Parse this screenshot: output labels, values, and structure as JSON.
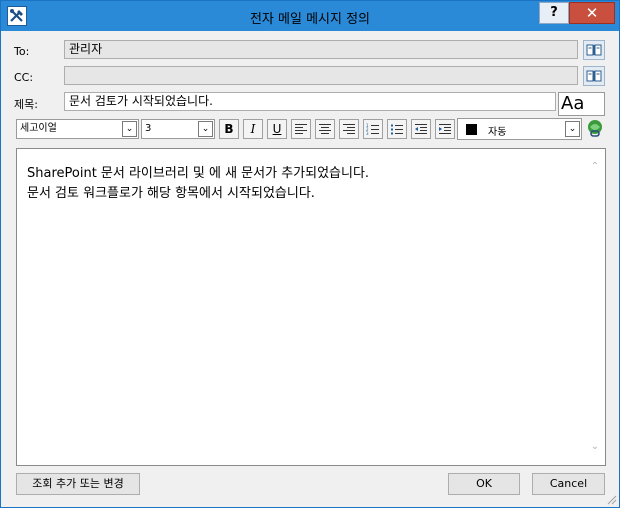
{
  "window": {
    "title": "전자 메일 메시지 정의",
    "help_label": "?",
    "close_label": "✕"
  },
  "fields": {
    "to_label": "To:",
    "to_value": "관리자",
    "cc_label": "CC:",
    "cc_value": "",
    "subject_label": "제목:",
    "subject_value": "문서 검토가 시작되었습니다."
  },
  "icons": {
    "address_book": "address-book-icon",
    "font_dialog": "font-aa-icon",
    "hyperlink": "hyperlink-icon",
    "app": "workflow-tools-icon"
  },
  "format_toolbar": {
    "font_name": "세고이얼",
    "font_size": "3",
    "bold_label": "B",
    "italic_label": "I",
    "underline_label": "U",
    "color_label": "자동",
    "font_dialog_label": "Aa"
  },
  "editor": {
    "line1": "SharePoint 문서 라이브러리 및 에 새 문서가 추가되었습니다.",
    "line2": "문서 검토 워크플로가 해당 항목에서 시작되었습니다."
  },
  "buttons": {
    "lookup_label": "조회 추가 또는 변경",
    "ok_label": "OK",
    "cancel_label": "Cancel"
  },
  "colors": {
    "titlebar": "#2b8ad8",
    "close_button": "#c9503e",
    "dialog_bg": "#f0f0f0",
    "text_color_swatch": "#000000"
  }
}
